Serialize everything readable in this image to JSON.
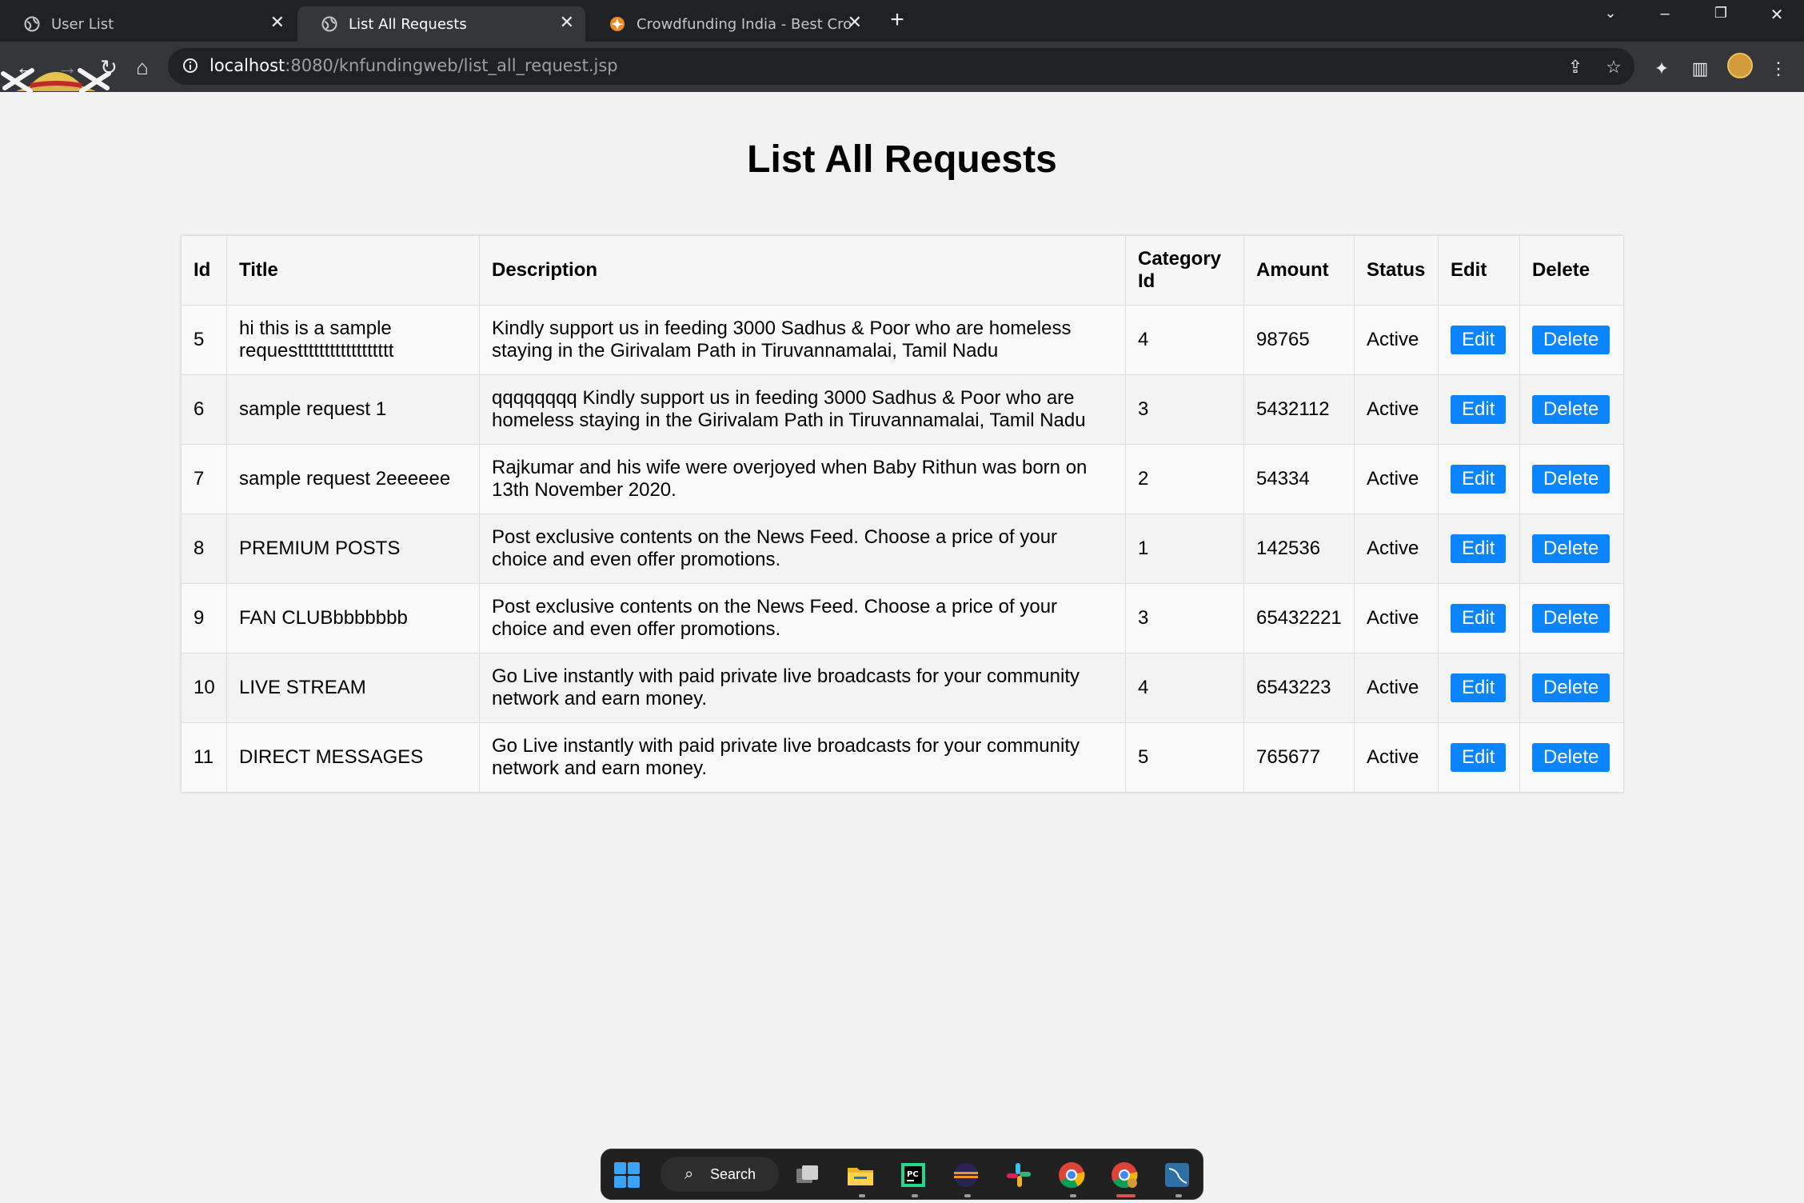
{
  "browser": {
    "tabs": [
      {
        "title": "User List",
        "active": false,
        "icon": "globe-icon"
      },
      {
        "title": "List All Requests",
        "active": true,
        "icon": "globe-icon"
      },
      {
        "title": "Crowdfunding India - Best Crowd",
        "active": false,
        "icon": "crowdfunding-favicon-icon"
      }
    ],
    "new_tab_glyph": "+",
    "address": {
      "host": "localhost",
      "path": ":8080/knfundingweb/list_all_request.jsp"
    }
  },
  "page": {
    "title": "List All Requests",
    "columns": [
      "Id",
      "Title",
      "Description",
      "Category Id",
      "Amount",
      "Status",
      "Edit",
      "Delete"
    ],
    "rows": [
      {
        "id": "5",
        "title": "hi this is a sample requestttttttttttttttttt",
        "description": "Kindly support us in feeding 3000 Sadhus & Poor who are homeless staying in the Girivalam Path in Tiruvannamalai, Tamil Nadu",
        "category_id": "4",
        "amount": "98765",
        "status": "Active",
        "edit": "Edit",
        "delete": "Delete"
      },
      {
        "id": "6",
        "title": "sample request 1",
        "description": "qqqqqqqq Kindly support us in feeding 3000 Sadhus & Poor who are homeless staying in the Girivalam Path in Tiruvannamalai, Tamil Nadu",
        "category_id": "3",
        "amount": "5432112",
        "status": "Active",
        "edit": "Edit",
        "delete": "Delete"
      },
      {
        "id": "7",
        "title": "sample request 2eeeeee",
        "description": "Rajkumar and his wife were overjoyed when Baby Rithun was born on 13th November 2020.",
        "category_id": "2",
        "amount": "54334",
        "status": "Active",
        "edit": "Edit",
        "delete": "Delete"
      },
      {
        "id": "8",
        "title": "PREMIUM POSTS",
        "description": "Post exclusive contents on the News Feed. Choose a price of your choice and even offer promotions.",
        "category_id": "1",
        "amount": "142536",
        "status": "Active",
        "edit": "Edit",
        "delete": "Delete"
      },
      {
        "id": "9",
        "title": "FAN CLUBbbbbbbb",
        "description": "Post exclusive contents on the News Feed. Choose a price of your choice and even offer promotions.",
        "category_id": "3",
        "amount": "65432221",
        "status": "Active",
        "edit": "Edit",
        "delete": "Delete"
      },
      {
        "id": "10",
        "title": "LIVE STREAM",
        "description": "Go Live instantly with paid private live broadcasts for your community network and earn money.",
        "category_id": "4",
        "amount": "6543223",
        "status": "Active",
        "edit": "Edit",
        "delete": "Delete"
      },
      {
        "id": "11",
        "title": "DIRECT MESSAGES",
        "description": "Go Live instantly with paid private live broadcasts for your community network and earn money.",
        "category_id": "5",
        "amount": "765677",
        "status": "Active",
        "edit": "Edit",
        "delete": "Delete"
      }
    ]
  },
  "taskbar": {
    "search_label": "Search",
    "apps": [
      "windows-start-icon",
      "task-view-icon",
      "file-explorer-icon",
      "pycharm-icon",
      "eclipse-icon",
      "slack-icon",
      "chrome-icon",
      "chrome-profile-icon",
      "mysql-workbench-icon"
    ]
  },
  "colors": {
    "button_blue": "#0a84ff",
    "page_bg": "#f2f2f2",
    "chrome_dark": "#35363a"
  }
}
